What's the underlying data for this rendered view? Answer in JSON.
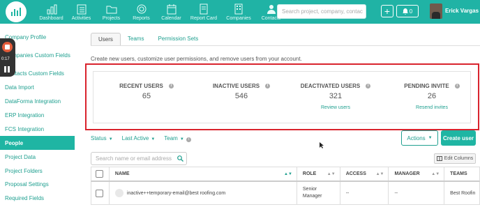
{
  "topbar": {
    "nav": [
      {
        "label": "Dashboard",
        "icon": "bar-chart-icon"
      },
      {
        "label": "Activities",
        "icon": "checklist-icon"
      },
      {
        "label": "Projects",
        "icon": "folder-icon"
      },
      {
        "label": "Reports",
        "icon": "target-icon"
      },
      {
        "label": "Calendar",
        "icon": "calendar-icon"
      },
      {
        "label": "Report Card",
        "icon": "document-icon"
      },
      {
        "label": "Companies",
        "icon": "building-icon"
      },
      {
        "label": "Contacts",
        "icon": "person-icon"
      }
    ],
    "search_placeholder": "Search project, company, contac",
    "notifications": "0",
    "user_name": "Erick Vargas"
  },
  "recorder": {
    "time": "0:17"
  },
  "sidebar": {
    "items": [
      {
        "label": "Company Profile"
      },
      {
        "label": "Companies Custom Fields"
      },
      {
        "label": "Contacts Custom Fields"
      },
      {
        "label": "Data Import"
      },
      {
        "label": "DataForma Integration"
      },
      {
        "label": "ERP Integration"
      },
      {
        "label": "FCS Integration"
      },
      {
        "label": "People"
      },
      {
        "label": "Project Data"
      },
      {
        "label": "Project Folders"
      },
      {
        "label": "Proposal Settings"
      },
      {
        "label": "Required Fields"
      }
    ],
    "active": "People"
  },
  "tabs": [
    {
      "label": "Users"
    },
    {
      "label": "Teams"
    },
    {
      "label": "Permission Sets"
    }
  ],
  "description": "Create new users, customize user permissions, and remove users from your account.",
  "stats": {
    "recent": {
      "title": "RECENT USERS",
      "value": "65"
    },
    "inactive": {
      "title": "INACTIVE USERS",
      "value": "546"
    },
    "deactivated": {
      "title": "DEACTIVATED USERS",
      "value": "321",
      "link": "Review users"
    },
    "pending": {
      "title": "PENDING INVITE",
      "value": "26",
      "link": "Resend invites"
    }
  },
  "filters": {
    "status": "Status",
    "last_active": "Last Active",
    "team": "Team"
  },
  "actions_label": "Actions",
  "create_label": "Create user",
  "table_search_placeholder": "Search name or email address",
  "edit_columns_label": "Edit Columns",
  "table": {
    "columns": [
      "NAME",
      "ROLE",
      "ACCESS",
      "MANAGER",
      "TEAMS"
    ],
    "rows": [
      {
        "name": "inactive++temporary-email@best roofing.com",
        "role": "Senior Manager",
        "access": "--",
        "manager": "--",
        "teams": "Best Roofin"
      }
    ]
  },
  "colors": {
    "brand": "#1fb5a3",
    "highlight": "#d9232d"
  }
}
